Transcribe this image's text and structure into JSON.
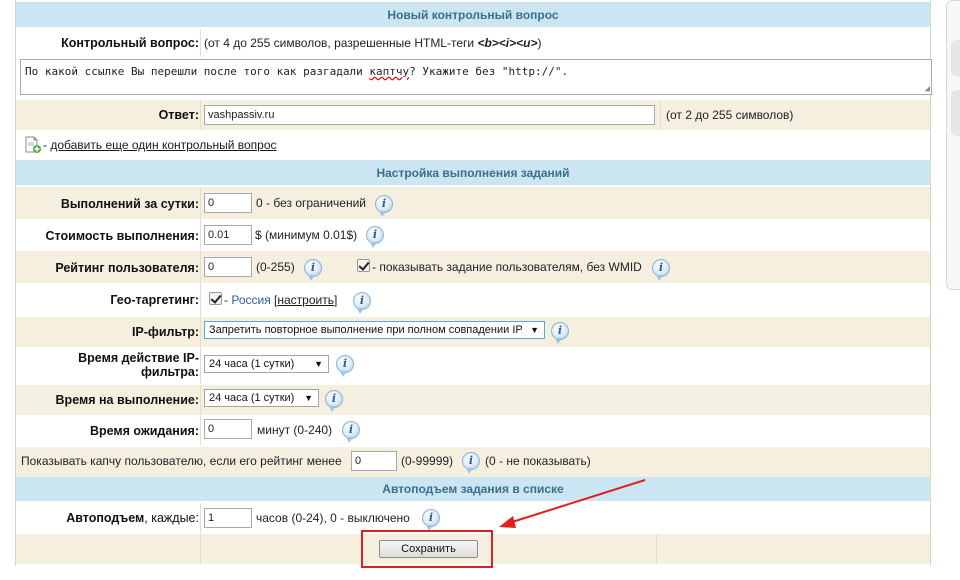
{
  "question_section": {
    "header": "Новый контрольный вопрос",
    "label": "Контрольный вопрос:",
    "hint_prefix": "(от 4 до 255 символов, разрешенные HTML-теги ",
    "hint_tags": "<b><i><u>",
    "hint_suffix": ")",
    "value_part1": "По какой ссылке Вы перешли после того как разгадали ",
    "value_misspelled": "каптчу",
    "value_part2": "? Укажите без \"http://\"."
  },
  "answer": {
    "label": "Ответ:",
    "value": "vashpassiv.ru",
    "hint": "(от 2 до 255 символов)"
  },
  "add_question": {
    "prefix": " - ",
    "link": "добавить еще один контрольный вопрос",
    "icon": "add-document-icon"
  },
  "settings_section": {
    "header": "Настройка выполнения заданий",
    "rows": {
      "daily": {
        "label": "Выполнений за сутки:",
        "value": "0",
        "note": "0 - без ограничений"
      },
      "cost": {
        "label": "Стоимость выполнения:",
        "value": "0.01",
        "note": "$ (минимум 0.01$)"
      },
      "rating": {
        "label": "Рейтинг пользователя:",
        "value": "0",
        "note": "(0-255)",
        "checkbox_label": " - показывать задание пользователям, без WMID",
        "checkbox_checked": true
      },
      "geo": {
        "label": "Гео-таргетинг:",
        "checked": true,
        "dash": " - ",
        "country": "Россия",
        "config_link": "настроить"
      },
      "ip_filter": {
        "label": "IP-фильтр:",
        "selected": "Запретить повторное выполнение при полном совпадении IP"
      },
      "ip_time": {
        "label_line1": "Время действие IP-",
        "label_line2": "фильтра:",
        "selected": "24 часа (1 сутки)"
      },
      "exec_time": {
        "label": "Время на выполнение:",
        "selected": "24 часа (1 сутки)"
      },
      "wait_time": {
        "label": "Время ожидания:",
        "value": "0",
        "note": "минут (0-240)"
      },
      "captcha": {
        "label": "Показывать капчу пользователю, если его рейтинг менее",
        "value": "0",
        "range": "(0-99999)",
        "note": "(0 - не показывать)"
      }
    }
  },
  "autoup_section": {
    "header": "Автоподъем задания в списке",
    "label_bold": "Автоподъем",
    "label_rest": ", каждые:",
    "value": "1",
    "note": "часов (0-24), 0 - выключено"
  },
  "save_button": "Сохранить",
  "colors": {
    "header_bg": "#cbe5f3",
    "header_text": "#3d6f8a",
    "row_beige": "#f4efdf",
    "highlight_red": "#e02020"
  }
}
